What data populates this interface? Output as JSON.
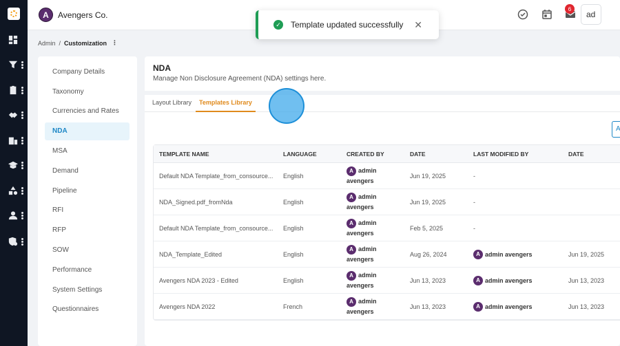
{
  "app": {
    "brand_initial": "A",
    "brand_name": "Avengers Co.",
    "notification_count": "6",
    "user_chip_text": "ad"
  },
  "toast": {
    "message": "Template updated successfully",
    "close_glyph": "✕",
    "check_glyph": "✓"
  },
  "breadcrumb": {
    "root": "Admin",
    "separator": "/",
    "current": "Customization",
    "menu_glyph": "⋮"
  },
  "settings_menu": {
    "items": [
      {
        "label": "Company Details"
      },
      {
        "label": "Taxonomy"
      },
      {
        "label": "Currencies and Rates"
      },
      {
        "label": "NDA"
      },
      {
        "label": "MSA"
      },
      {
        "label": "Demand"
      },
      {
        "label": "Pipeline"
      },
      {
        "label": "RFI"
      },
      {
        "label": "RFP"
      },
      {
        "label": "SOW"
      },
      {
        "label": "Performance"
      },
      {
        "label": "System Settings"
      },
      {
        "label": "Questionnaires"
      }
    ],
    "active": "NDA"
  },
  "main": {
    "title": "NDA",
    "subtitle": "Manage Non Disclosure Agreement (NDA) settings here.",
    "tabs": [
      {
        "label": "Layout Library"
      },
      {
        "label": "Templates Library"
      }
    ],
    "active_tab": "Templates Library",
    "add_button_label": "A"
  },
  "table": {
    "columns": [
      "TEMPLATE NAME",
      "LANGUAGE",
      "CREATED BY",
      "DATE",
      "LAST MODIFIED BY",
      "DATE"
    ],
    "rows": [
      {
        "name": "Default NDA Template_from_consource...",
        "language": "English",
        "created_by_1": "admin",
        "created_by_2": "avengers",
        "date": "Jun 19, 2025",
        "modified_by": "-",
        "modified_date": ""
      },
      {
        "name": "NDA_Signed.pdf_fromNda",
        "language": "English",
        "created_by_1": "admin",
        "created_by_2": "avengers",
        "date": "Jun 19, 2025",
        "modified_by": "-",
        "modified_date": ""
      },
      {
        "name": "Default NDA Template_from_consource...",
        "language": "English",
        "created_by_1": "admin",
        "created_by_2": "avengers",
        "date": "Feb 5, 2025",
        "modified_by": "-",
        "modified_date": ""
      },
      {
        "name": "NDA_Template_Edited",
        "language": "English",
        "created_by_1": "admin",
        "created_by_2": "avengers",
        "date": "Aug 26, 2024",
        "modified_by": "admin avengers",
        "modified_date": "Jun 19, 2025"
      },
      {
        "name": "Avengers NDA 2023 - Edited",
        "language": "English",
        "created_by_1": "admin",
        "created_by_2": "avengers",
        "date": "Jun 13, 2023",
        "modified_by": "admin avengers",
        "modified_date": "Jun 13, 2023"
      },
      {
        "name": "Avengers NDA 2022",
        "language": "French",
        "created_by_1": "admin",
        "created_by_2": "avengers",
        "date": "Jun 13, 2023",
        "modified_by": "admin avengers",
        "modified_date": "Jun 13, 2023"
      }
    ]
  },
  "icons": {
    "rail": [
      "dashboard-icon",
      "filter-icon",
      "clipboard-icon",
      "handshake-icon",
      "building-icon",
      "graduation-cap-icon",
      "shapes-icon",
      "user-icon",
      "settings-shield-icon"
    ],
    "topbar": [
      "check-circle-icon",
      "calendar-icon",
      "mail-icon",
      "bell-icon"
    ]
  },
  "colors": {
    "rail_bg": "#0f1623",
    "accent_blue": "#1d87c6",
    "tab_orange": "#e08a1c",
    "success_green": "#1f9d55",
    "badge_red": "#e0262f",
    "avatar_purple": "#5b2d6e"
  }
}
